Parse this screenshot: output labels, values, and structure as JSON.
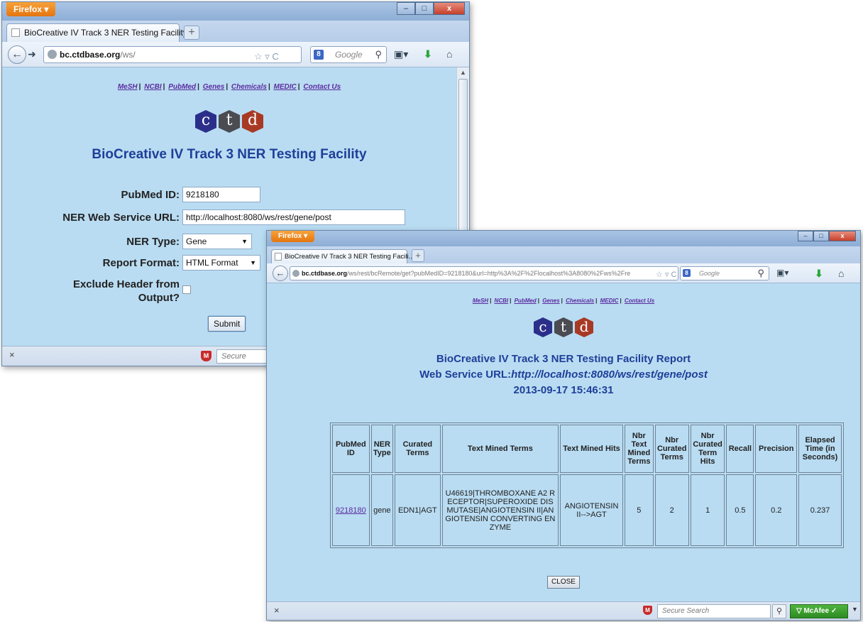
{
  "browser": {
    "app_button": "Firefox",
    "min": "–",
    "max": "□",
    "close": "x",
    "new_tab": "+",
    "search_engine_placeholder": "Google",
    "google_logo": "8",
    "status_close": "×",
    "secure_search": "Secure Search",
    "mcafee_label": "McAfee"
  },
  "form_window": {
    "tab_title": "BioCreative IV Track 3 NER Testing Facility",
    "url_domain": "bc.ctdbase.org",
    "url_path": "/ws/",
    "nav_links": [
      "MeSH",
      "NCBI",
      "PubMed",
      "Genes",
      "Chemicals",
      "MEDIC",
      "Contact Us"
    ],
    "logo_letters": [
      "c",
      "t",
      "d"
    ],
    "page_title": "BioCreative IV Track 3 NER Testing Facility",
    "fields": {
      "pubmed_label": "PubMed ID:",
      "pubmed_value": "9218180",
      "url_label": "NER Web Service URL:",
      "url_value": "http://localhost:8080/ws/rest/gene/post",
      "type_label": "NER Type:",
      "type_value": "Gene",
      "format_label": "Report Format:",
      "format_value": "HTML Format",
      "exclude_label_1": "Exclude Header from",
      "exclude_label_2": "Output?"
    },
    "submit_label": "Submit"
  },
  "report_window": {
    "tab_title": "BioCreative IV Track 3 NER Testing Facili...",
    "url_domain": "bc.ctdbase.org",
    "url_path": "/ws/rest/bcRemote/get?pubMedID=9218180&url=http%3A%2F%2Flocalhost%3A8080%2Fws%2Fre",
    "nav_links": [
      "MeSH",
      "NCBI",
      "PubMed",
      "Genes",
      "Chemicals",
      "MEDIC",
      "Contact Us"
    ],
    "logo_letters": [
      "c",
      "t",
      "d"
    ],
    "report_title": "BioCreative IV Track 3 NER Testing Facility Report",
    "url_line_label": "Web Service URL:",
    "url_line_value": "http://localhost:8080/ws/rest/gene/post",
    "timestamp": "2013-09-17 15:46:31",
    "table": {
      "headers": [
        "PubMed ID",
        "NER Type",
        "Curated Terms",
        "Text Mined Terms",
        "Text Mined Hits",
        "Nbr Text Mined Terms",
        "Nbr Curated Terms",
        "Nbr Curated Term Hits",
        "Recall",
        "Precision",
        "Elapsed Time (in Seconds)"
      ],
      "row": {
        "pubmed_id": "9218180",
        "ner_type": "gene",
        "curated_terms": "EDN1|AGT",
        "text_mined_terms": "U46619|THROMBOXANE A2 RECEPTOR|SUPEROXIDE DISMUTASE|ANGIOTENSIN II|ANGIOTENSIN CONVERTING ENZYME",
        "text_mined_hits": "ANGIOTENSIN II-->AGT",
        "nbr_text_mined_terms": "5",
        "nbr_curated_terms": "2",
        "nbr_curated_term_hits": "1",
        "recall": "0.5",
        "precision": "0.2",
        "elapsed_time": "0.237"
      }
    },
    "close_label": "CLOSE"
  }
}
